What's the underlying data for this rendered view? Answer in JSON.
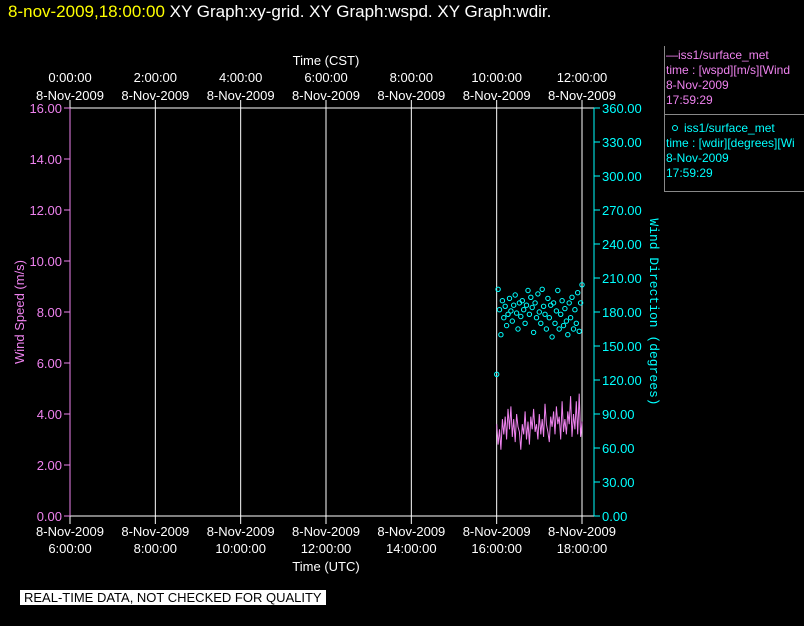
{
  "header": {
    "timestamp": "8-nov-2009,18:00:00",
    "graphs": "XY Graph:xy-grid.  XY Graph:wspd.  XY Graph:wdir."
  },
  "watermark": "REAL-TIME DATA, NOT CHECKED FOR QUALITY",
  "legend": {
    "series1": {
      "title": "—iss1/surface_met",
      "line2": "time : [wspd][m/s][Wind",
      "date": "8-Nov-2009",
      "time": "17:59:29",
      "color": "#ee82ee"
    },
    "series2": {
      "title": "iss1/surface_met",
      "line2": "time : [wdir][degrees][Wi",
      "date": "8-Nov-2009",
      "time": "17:59:29",
      "color": "#00ffff"
    }
  },
  "chart_data": {
    "type": "line",
    "top_axis": {
      "title": "Time (CST)",
      "ticks": [
        {
          "time": "0:00:00",
          "date": "8-Nov-2009"
        },
        {
          "time": "2:00:00",
          "date": "8-Nov-2009"
        },
        {
          "time": "4:00:00",
          "date": "8-Nov-2009"
        },
        {
          "time": "6:00:00",
          "date": "8-Nov-2009"
        },
        {
          "time": "8:00:00",
          "date": "8-Nov-2009"
        },
        {
          "time": "10:00:00",
          "date": "8-Nov-2009"
        },
        {
          "time": "12:00:00",
          "date": "8-Nov-2009"
        }
      ]
    },
    "bottom_axis": {
      "title": "Time (UTC)",
      "ticks": [
        {
          "date": "8-Nov-2009",
          "time": "6:00:00"
        },
        {
          "date": "8-Nov-2009",
          "time": "8:00:00"
        },
        {
          "date": "8-Nov-2009",
          "time": "10:00:00"
        },
        {
          "date": "8-Nov-2009",
          "time": "12:00:00"
        },
        {
          "date": "8-Nov-2009",
          "time": "14:00:00"
        },
        {
          "date": "8-Nov-2009",
          "time": "16:00:00"
        },
        {
          "date": "8-Nov-2009",
          "time": "18:00:00"
        }
      ],
      "xlim": [
        "2009-11-08 06:00:00",
        "2009-11-08 18:00:00"
      ]
    },
    "left_axis": {
      "title": "Wind Speed (m/s)",
      "ticks": [
        "0.00",
        "2.00",
        "4.00",
        "6.00",
        "8.00",
        "10.00",
        "12.00",
        "14.00",
        "16.00"
      ],
      "ylim": [
        0,
        16
      ],
      "color": "#ee82ee"
    },
    "right_axis": {
      "title": "Wind Direction (degrees)",
      "ticks": [
        "0.00",
        "30.00",
        "60.00",
        "90.00",
        "120.00",
        "150.00",
        "180.00",
        "210.00",
        "240.00",
        "270.00",
        "300.00",
        "330.00",
        "360.00"
      ],
      "ylim": [
        0,
        360
      ],
      "color": "#00ffff"
    },
    "grid": "vertical lines at bottom axis ticks",
    "series": [
      {
        "name": "iss1/surface_met wspd",
        "style": "line",
        "axis": "left",
        "color": "#ee82ee",
        "x": [
          "16:00",
          "16:02",
          "16:04",
          "16:06",
          "16:08",
          "16:10",
          "16:12",
          "16:14",
          "16:16",
          "16:18",
          "16:20",
          "16:22",
          "16:24",
          "16:26",
          "16:28",
          "16:30",
          "16:32",
          "16:34",
          "16:36",
          "16:38",
          "16:40",
          "16:42",
          "16:44",
          "16:46",
          "16:48",
          "16:50",
          "16:52",
          "16:54",
          "16:56",
          "16:58",
          "17:00",
          "17:02",
          "17:04",
          "17:06",
          "17:08",
          "17:10",
          "17:12",
          "17:14",
          "17:16",
          "17:18",
          "17:20",
          "17:22",
          "17:24",
          "17:26",
          "17:28",
          "17:30",
          "17:32",
          "17:34",
          "17:36",
          "17:38",
          "17:40",
          "17:42",
          "17:44",
          "17:46",
          "17:48",
          "17:50",
          "17:52",
          "17:54",
          "17:56",
          "17:58",
          "18:00"
        ],
        "values": [
          3.6,
          2.8,
          3.4,
          2.6,
          3.8,
          3.2,
          3.9,
          3.0,
          4.2,
          3.4,
          4.3,
          3.1,
          3.8,
          2.9,
          4.0,
          3.5,
          3.3,
          2.6,
          3.6,
          3.2,
          4.1,
          3.0,
          3.7,
          2.8,
          3.9,
          3.4,
          4.2,
          3.3,
          3.6,
          3.0,
          4.0,
          3.2,
          3.8,
          3.1,
          4.4,
          3.6,
          3.3,
          2.9,
          3.9,
          3.5,
          4.1,
          3.2,
          4.3,
          3.6,
          3.9,
          3.0,
          4.5,
          3.3,
          3.8,
          3.2,
          4.1,
          3.6,
          4.7,
          3.1,
          4.0,
          3.4,
          4.5,
          3.2,
          4.8,
          3.1,
          3.7
        ]
      },
      {
        "name": "iss1/surface_met wdir",
        "style": "scatter",
        "axis": "right",
        "color": "#00ffff",
        "x": [
          "16:00",
          "16:02",
          "16:04",
          "16:06",
          "16:08",
          "16:10",
          "16:12",
          "16:14",
          "16:16",
          "16:18",
          "16:20",
          "16:22",
          "16:24",
          "16:26",
          "16:28",
          "16:30",
          "16:32",
          "16:34",
          "16:36",
          "16:38",
          "16:40",
          "16:42",
          "16:44",
          "16:46",
          "16:48",
          "16:50",
          "16:52",
          "16:54",
          "16:56",
          "16:58",
          "17:00",
          "17:02",
          "17:04",
          "17:06",
          "17:08",
          "17:10",
          "17:12",
          "17:14",
          "17:16",
          "17:18",
          "17:20",
          "17:22",
          "17:24",
          "17:26",
          "17:28",
          "17:30",
          "17:32",
          "17:34",
          "17:36",
          "17:38",
          "17:40",
          "17:42",
          "17:44",
          "17:46",
          "17:48",
          "17:50",
          "17:52",
          "17:54",
          "17:56",
          "17:58",
          "18:00"
        ],
        "values": [
          125,
          200,
          182,
          160,
          190,
          175,
          185,
          168,
          178,
          192,
          181,
          172,
          186,
          195,
          179,
          165,
          188,
          176,
          190,
          182,
          170,
          186,
          199,
          178,
          193,
          184,
          162,
          188,
          175,
          196,
          180,
          170,
          200,
          185,
          178,
          165,
          192,
          175,
          186,
          158,
          188,
          170,
          181,
          199,
          165,
          178,
          190,
          168,
          183,
          172,
          160,
          188,
          175,
          193,
          165,
          182,
          170,
          197,
          163,
          188,
          204
        ]
      }
    ]
  }
}
